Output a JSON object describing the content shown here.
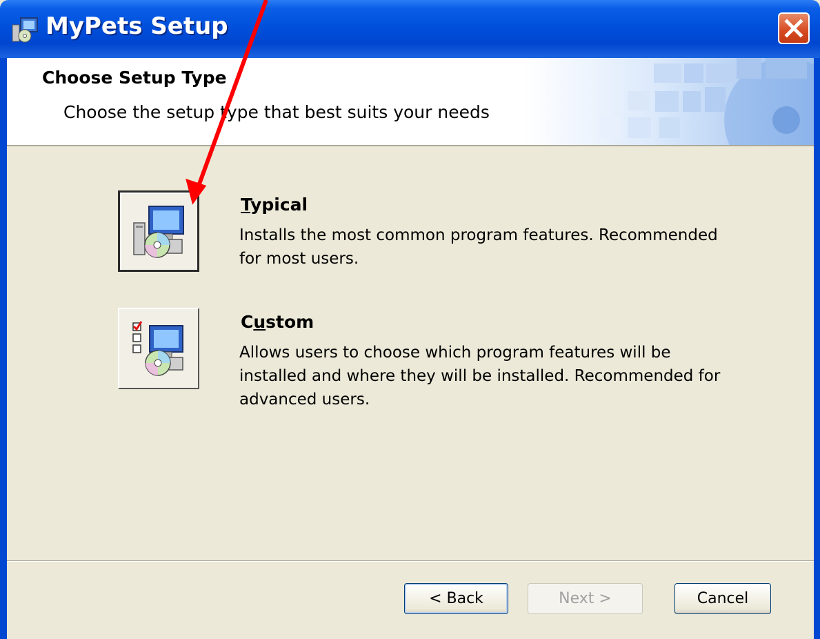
{
  "window": {
    "title": "MyPets Setup"
  },
  "header": {
    "title": "Choose Setup Type",
    "subtitle": "Choose the setup type that best suits your needs"
  },
  "options": [
    {
      "title_mnemonic": "T",
      "title_rest": "ypical",
      "description": "Installs the most common program features. Recommended for most users.",
      "icon": "computer-cd-install-icon"
    },
    {
      "title_prefix": "C",
      "title_mnemonic": "u",
      "title_rest": "stom",
      "description": "Allows users to choose which program features will be installed and where they will be installed. Recommended for advanced users.",
      "icon": "computer-cd-checklist-icon"
    }
  ],
  "buttons": {
    "back": "< Back",
    "next": "Next >",
    "cancel": "Cancel"
  },
  "colors": {
    "titlebar": "#0050dc",
    "annotation_arrow": "#ff0000",
    "face": "#ECE9D8"
  }
}
